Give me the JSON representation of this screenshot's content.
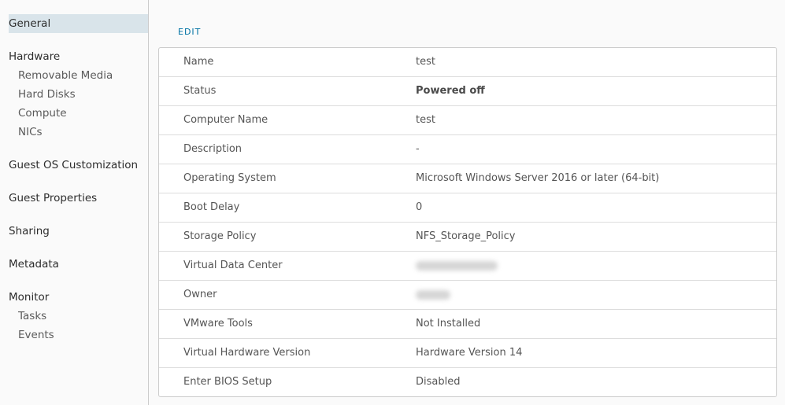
{
  "sidebar": {
    "general": "General",
    "hardware": "Hardware",
    "hardware_items": [
      "Removable Media",
      "Hard Disks",
      "Compute",
      "NICs"
    ],
    "guest_os_customization": "Guest OS Customization",
    "guest_properties": "Guest Properties",
    "sharing": "Sharing",
    "metadata": "Metadata",
    "monitor": "Monitor",
    "monitor_items": [
      "Tasks",
      "Events"
    ]
  },
  "main": {
    "edit_label": "EDIT",
    "properties": [
      {
        "key": "Name",
        "value": "test"
      },
      {
        "key": "Status",
        "value": "Powered off"
      },
      {
        "key": "Computer Name",
        "value": "test"
      },
      {
        "key": "Description",
        "value": "-"
      },
      {
        "key": "Operating System",
        "value": "Microsoft Windows Server 2016 or later (64-bit)"
      },
      {
        "key": "Boot Delay",
        "value": "0"
      },
      {
        "key": "Storage Policy",
        "value": "NFS_Storage_Policy"
      },
      {
        "key": "Virtual Data Center",
        "value": ""
      },
      {
        "key": "Owner",
        "value": ""
      },
      {
        "key": "VMware Tools",
        "value": "Not Installed"
      },
      {
        "key": "Virtual Hardware Version",
        "value": "Hardware Version 14"
      },
      {
        "key": "Enter BIOS Setup",
        "value": "Disabled"
      }
    ]
  }
}
